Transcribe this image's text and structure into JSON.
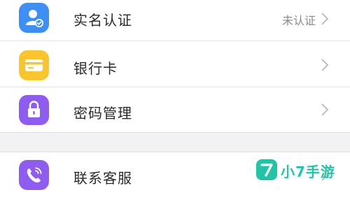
{
  "menu_primary": [
    {
      "label": "实名认证",
      "value": "未认证",
      "icon": "id-verify-icon",
      "color": "#3d8ef5"
    },
    {
      "label": "银行卡",
      "value": "",
      "icon": "bank-card-icon",
      "color": "#f9c42c"
    },
    {
      "label": "密码管理",
      "value": "",
      "icon": "lock-icon",
      "color": "#8e5cf0"
    }
  ],
  "menu_secondary": [
    {
      "label": "联系客服",
      "value": "",
      "icon": "phone-icon",
      "color": "#8e5cf0"
    }
  ],
  "watermark": {
    "badge": "7",
    "text": "小7手游",
    "color": "#22c4a5"
  },
  "colors": {
    "background": "#f2f2f4",
    "chevron": "#b8b8b8"
  }
}
